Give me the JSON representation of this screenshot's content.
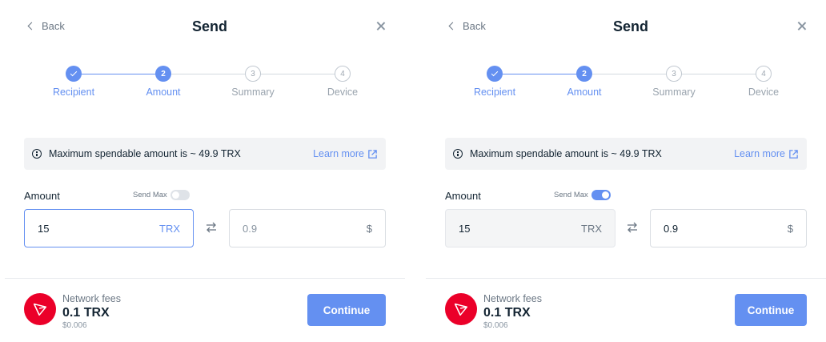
{
  "colors": {
    "accent": "#6490f1",
    "tron_red": "#eb0029",
    "text": "#142533",
    "muted": "#6b7784"
  },
  "panels": [
    {
      "header": {
        "back_label": "Back",
        "title": "Send"
      },
      "steps": [
        {
          "number": "1",
          "label": "Recipient",
          "state": "done"
        },
        {
          "number": "2",
          "label": "Amount",
          "state": "active"
        },
        {
          "number": "3",
          "label": "Summary",
          "state": "todo"
        },
        {
          "number": "4",
          "label": "Device",
          "state": "todo"
        }
      ],
      "info": {
        "text": "Maximum spendable amount is ~ 49.9 TRX",
        "link": "Learn more"
      },
      "amount": {
        "label": "Amount",
        "send_max_label": "Send Max",
        "send_max_on": false,
        "crypto_value": "15",
        "crypto_unit": "TRX",
        "fiat_value": "0.9",
        "fiat_unit": "$"
      },
      "fees": {
        "label": "Network fees",
        "amount": "0.1 TRX",
        "fiat": "$0.006"
      },
      "continue_label": "Continue"
    },
    {
      "header": {
        "back_label": "Back",
        "title": "Send"
      },
      "steps": [
        {
          "number": "1",
          "label": "Recipient",
          "state": "done"
        },
        {
          "number": "2",
          "label": "Amount",
          "state": "active"
        },
        {
          "number": "3",
          "label": "Summary",
          "state": "todo"
        },
        {
          "number": "4",
          "label": "Device",
          "state": "todo"
        }
      ],
      "info": {
        "text": "Maximum spendable amount is ~ 49.9 TRX",
        "link": "Learn more"
      },
      "amount": {
        "label": "Amount",
        "send_max_label": "Send Max",
        "send_max_on": true,
        "crypto_value": "15",
        "crypto_unit": "TRX",
        "fiat_value": "0.9",
        "fiat_unit": "$"
      },
      "fees": {
        "label": "Network fees",
        "amount": "0.1 TRX",
        "fiat": "$0.006"
      },
      "continue_label": "Continue"
    }
  ]
}
